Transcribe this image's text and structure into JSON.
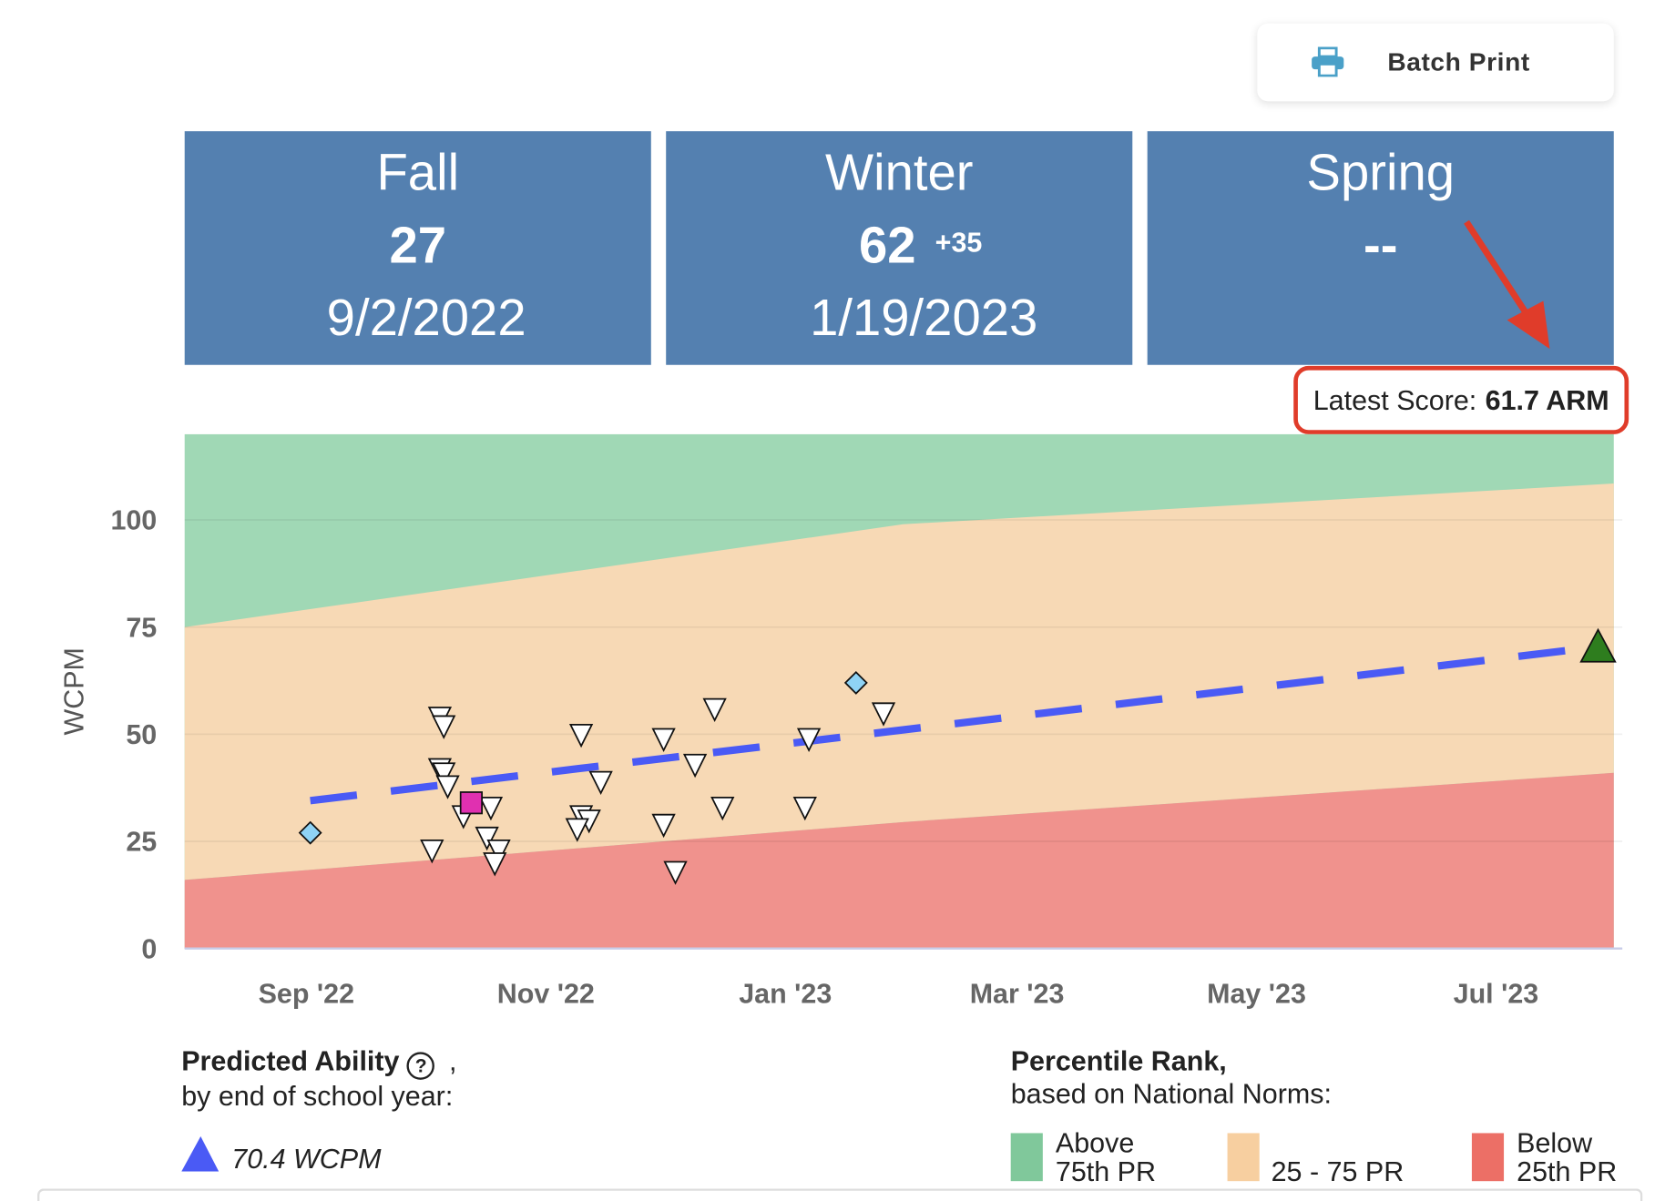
{
  "header": {
    "batch_print_label": "Batch Print",
    "print_icon": "printer-icon"
  },
  "seasons": [
    {
      "title": "Fall",
      "score": "27",
      "delta": "",
      "date": "9/2/2022"
    },
    {
      "title": "Winter",
      "score": "62",
      "delta": "+35",
      "date": "1/19/2023"
    },
    {
      "title": "Spring",
      "score": "--",
      "delta": "",
      "date": ""
    }
  ],
  "latest_score": {
    "label": "Latest Score:",
    "value": "61.7 ARM"
  },
  "colors": {
    "card": "#5480b0",
    "above": "#a0d8b5",
    "middle": "#f7d9b5",
    "below": "#f0928d",
    "trend": "#4a5af5",
    "highlight": "#e03c2a"
  },
  "chart_data": {
    "type": "scatter",
    "ylabel": "WCPM",
    "ylim": [
      0,
      120
    ],
    "yticks": [
      0,
      25,
      50,
      75,
      100
    ],
    "xlim": [
      "2022-08-01",
      "2023-07-31"
    ],
    "xticks": [
      {
        "date": "2022-09-01",
        "label": "Sep '22"
      },
      {
        "date": "2022-11-01",
        "label": "Nov '22"
      },
      {
        "date": "2023-01-01",
        "label": "Jan '23"
      },
      {
        "date": "2023-03-01",
        "label": "Mar '23"
      },
      {
        "date": "2023-05-01",
        "label": "May '23"
      },
      {
        "date": "2023-07-01",
        "label": "Jul '23"
      }
    ],
    "grid": true,
    "bands": {
      "dates": [
        "2022-08-01",
        "2023-01-31",
        "2023-07-31"
      ],
      "p25": [
        16,
        29.5,
        41
      ],
      "p75": [
        75,
        99,
        108.5
      ]
    },
    "benchmarks": [
      {
        "date": "2022-09-02",
        "value": 27
      },
      {
        "date": "2023-01-19",
        "value": 62
      }
    ],
    "highlight_point": {
      "date": "2022-10-13",
      "value": 34
    },
    "progress_points": [
      {
        "date": "2022-10-05",
        "value": 54
      },
      {
        "date": "2022-10-06",
        "value": 52
      },
      {
        "date": "2022-10-05",
        "value": 42
      },
      {
        "date": "2022-10-06",
        "value": 41
      },
      {
        "date": "2022-10-07",
        "value": 38
      },
      {
        "date": "2022-10-11",
        "value": 31
      },
      {
        "date": "2022-10-18",
        "value": 33
      },
      {
        "date": "2022-10-17",
        "value": 26
      },
      {
        "date": "2022-10-03",
        "value": 23
      },
      {
        "date": "2022-10-20",
        "value": 23
      },
      {
        "date": "2022-10-19",
        "value": 20
      },
      {
        "date": "2022-11-10",
        "value": 50
      },
      {
        "date": "2022-11-10",
        "value": 31
      },
      {
        "date": "2022-11-12",
        "value": 30
      },
      {
        "date": "2022-11-09",
        "value": 28
      },
      {
        "date": "2022-11-15",
        "value": 39
      },
      {
        "date": "2022-12-01",
        "value": 49
      },
      {
        "date": "2022-12-01",
        "value": 29
      },
      {
        "date": "2022-12-04",
        "value": 18
      },
      {
        "date": "2022-12-09",
        "value": 43
      },
      {
        "date": "2022-12-14",
        "value": 56
      },
      {
        "date": "2022-12-16",
        "value": 33
      },
      {
        "date": "2023-01-07",
        "value": 49
      },
      {
        "date": "2023-01-06",
        "value": 33
      },
      {
        "date": "2023-01-26",
        "value": 55
      }
    ],
    "trend": [
      {
        "date": "2022-09-02",
        "value": 34.5
      },
      {
        "date": "2023-07-27",
        "value": 70.4
      }
    ],
    "predicted": {
      "date": "2023-07-27",
      "value": 70.4
    }
  },
  "predicted_legend": {
    "title": "Predicted Ability",
    "suffix": ",",
    "subtitle": "by end of school year:",
    "value": "70.4 WCPM"
  },
  "percentile_legend": {
    "title": "Percentile Rank,",
    "subtitle": "based on National Norms:",
    "items": [
      {
        "line1": "Above",
        "line2": "75th PR"
      },
      {
        "line1": "",
        "line2": "25 - 75 PR"
      },
      {
        "line1": "Below",
        "line2": "25th PR"
      }
    ]
  }
}
